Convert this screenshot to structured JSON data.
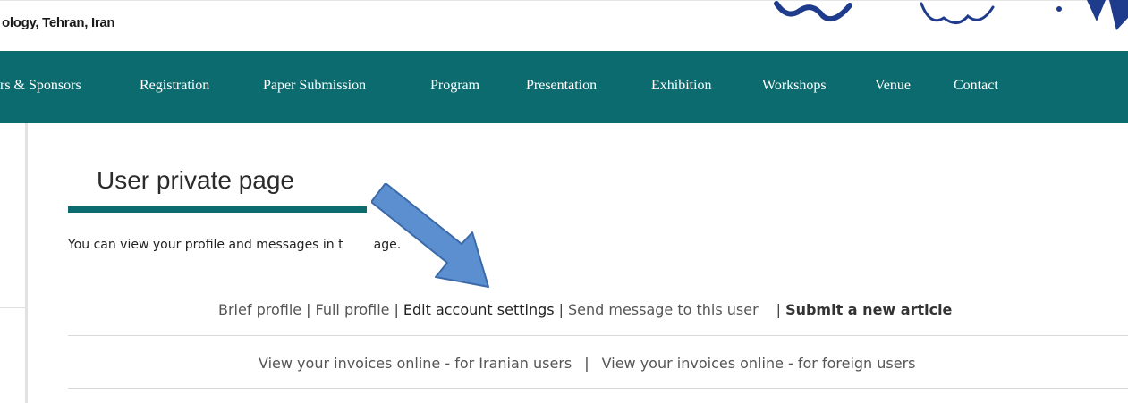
{
  "header": {
    "affiliation_text": "ology, Tehran, Iran"
  },
  "nav": {
    "items": [
      {
        "label": "rs & Sponsors"
      },
      {
        "label": "Registration"
      },
      {
        "label": "Paper Submission"
      },
      {
        "label": "Program"
      },
      {
        "label": "Presentation"
      },
      {
        "label": "Exhibition"
      },
      {
        "label": "Workshops"
      },
      {
        "label": "Venue"
      },
      {
        "label": "Contact"
      }
    ]
  },
  "main": {
    "title": "User private page",
    "intro_start": "You can view your profile and messages in t",
    "intro_end": "age.",
    "links": {
      "brief_profile": "Brief profile",
      "full_profile": "Full profile",
      "edit_account": "Edit account settings",
      "send_message": "Send message to this user",
      "submit_article": "Submit a new article",
      "separator": "|"
    },
    "invoices": {
      "iranian": "View your invoices online - for Iranian users",
      "foreign": "View your invoices online - for foreign users",
      "separator": "|"
    }
  },
  "colors": {
    "brand_teal": "#0c6b6e",
    "arrow_fill": "#5b8fd0",
    "arrow_stroke": "#3c6aa8",
    "logo_blue": "#1f3b8c"
  }
}
